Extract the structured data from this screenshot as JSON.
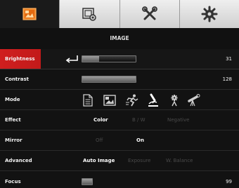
{
  "tabs": [
    {
      "icon": "image-settings-icon",
      "active": true
    },
    {
      "icon": "camera-settings-icon",
      "active": false
    },
    {
      "icon": "tools-icon",
      "active": false
    },
    {
      "icon": "gear-icon",
      "active": false
    }
  ],
  "section_title": "IMAGE",
  "rows": {
    "brightness": {
      "label": "Brightness",
      "value": "31",
      "level": 0.31
    },
    "contrast": {
      "label": "Contrast",
      "value": "128",
      "level": 1.0
    },
    "mode": {
      "label": "Mode",
      "icons": [
        "document-icon",
        "picture-icon",
        "sports-icon",
        "microscope-icon",
        "gear-mode-icon",
        "telescope-icon"
      ]
    },
    "effect": {
      "label": "Effect",
      "options": [
        "Color",
        "B / W",
        "Negative"
      ],
      "selected": "Color"
    },
    "mirror": {
      "label": "Mirror",
      "options": [
        "Off",
        "On"
      ],
      "selected": "On"
    },
    "advanced": {
      "label": "Advanced",
      "options": [
        "Auto Image",
        "Exposure",
        "W. Balance"
      ],
      "selected": "Auto Image"
    },
    "focus": {
      "label": "Focus",
      "value": "99",
      "level": 0.0
    }
  },
  "colors": {
    "accent": "#d01f1f",
    "background": "#121212"
  }
}
